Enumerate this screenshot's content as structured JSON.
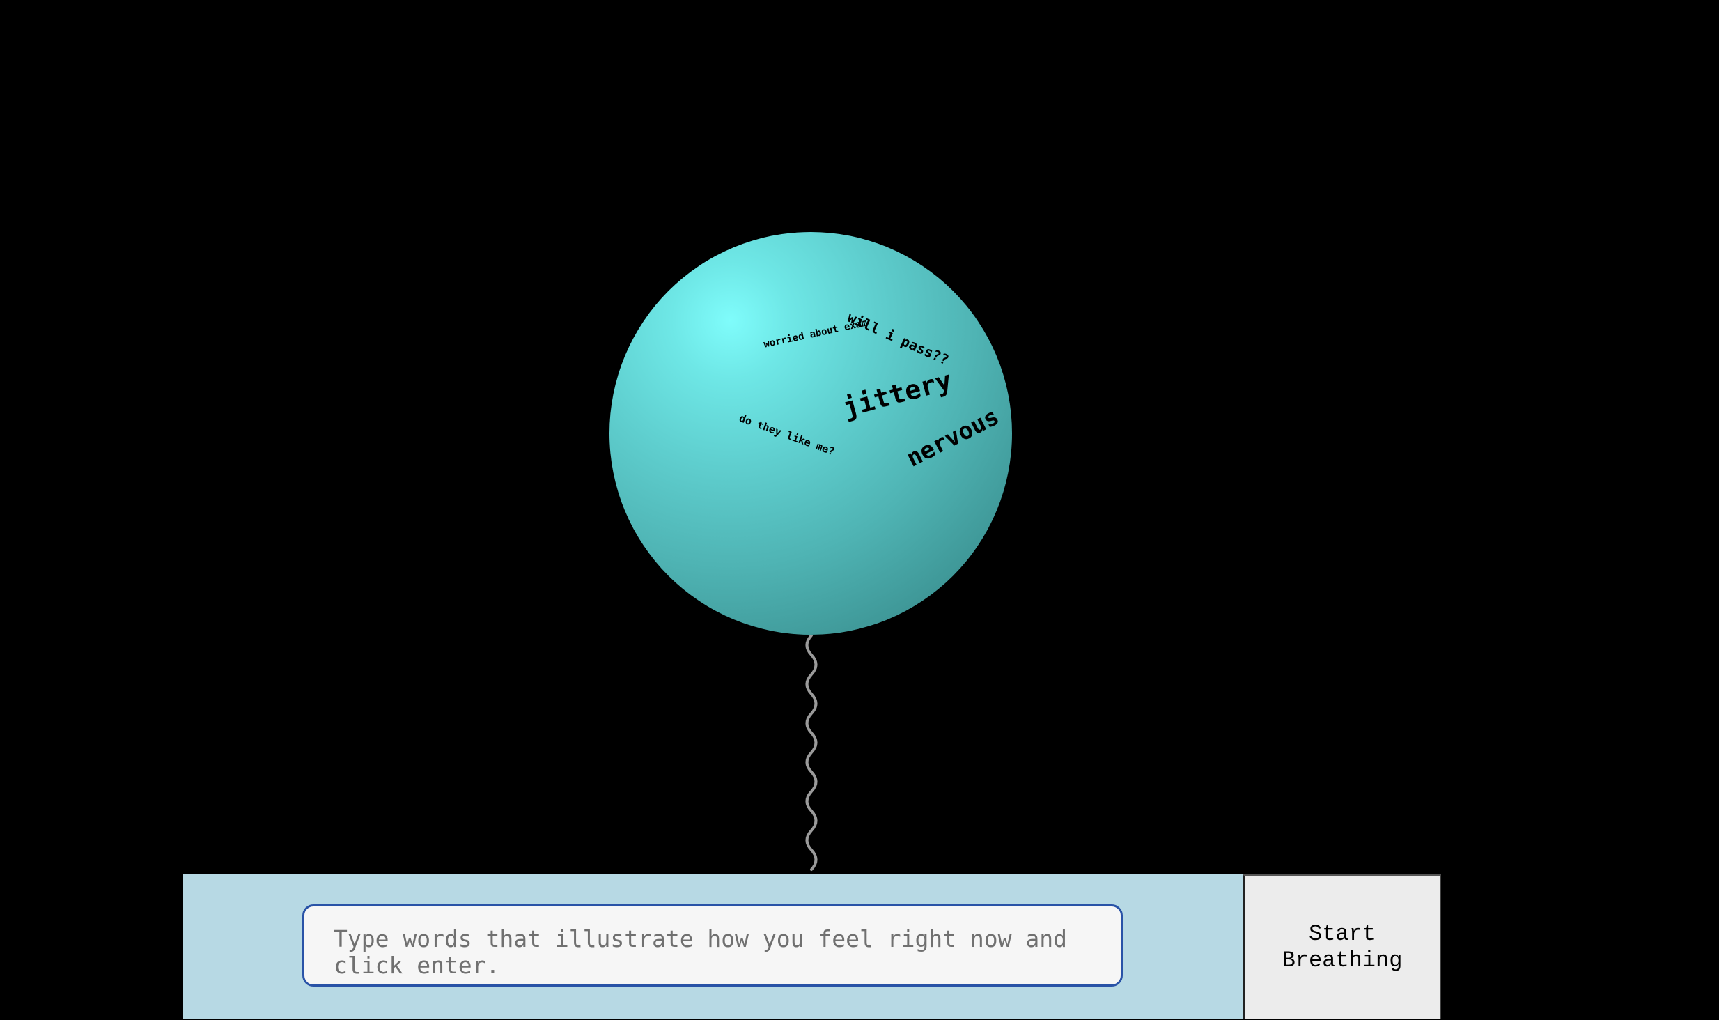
{
  "balloon": {
    "color": "#5fcfcf",
    "words": [
      "worried about exam",
      "will i pass??",
      "jittery",
      "do they like me?",
      "nervous"
    ]
  },
  "input": {
    "placeholder": "Type words that illustrate how you feel right now and click enter.",
    "value": ""
  },
  "button": {
    "label": "Start Breathing"
  },
  "colors": {
    "background": "#000000",
    "panel": "#b7d9e4",
    "input_border": "#2953a7",
    "button_bg": "#ececec"
  }
}
